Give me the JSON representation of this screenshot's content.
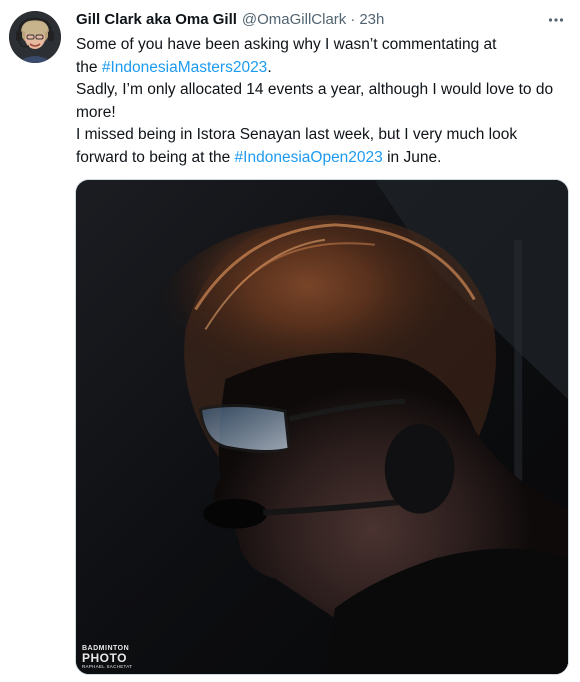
{
  "author": {
    "display_name": "Gill Clark aka Oma Gill",
    "handle": "@OmaGillClark",
    "separator": "·",
    "time": "23h"
  },
  "tweet": {
    "line1": "Some of you have been asking why I wasn’t commentating at",
    "line2_pre": "the ",
    "hashtag1": "#IndonesiaMasters2023",
    "line2_post": ".",
    "line3": "Sadly, I’m only allocated 14 events a year, although I would love to do more!",
    "line4_pre": "I missed being in Istora Senayan last week, but I very much look forward to being at the ",
    "hashtag2": "#IndonesiaOpen2023",
    "line4_post": " in June."
  },
  "media": {
    "watermark_line1": "BADMINTON",
    "watermark_line2": "PHOTO",
    "watermark_line3": "RAPHAEL SACHETAT"
  },
  "icons": {
    "more": "more-horizontal-icon",
    "avatar": "avatar"
  },
  "colors": {
    "text": "#0f1419",
    "secondary": "#536471",
    "link": "#1d9bf0"
  }
}
